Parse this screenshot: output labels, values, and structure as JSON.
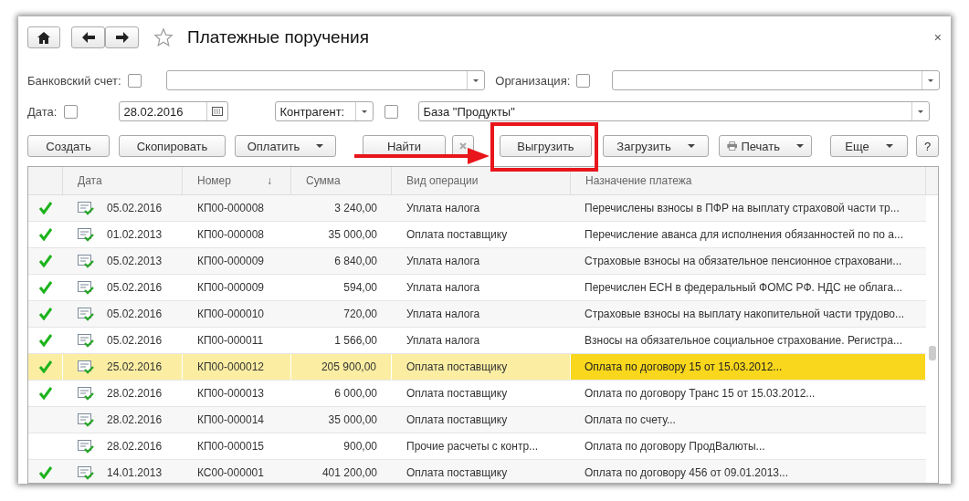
{
  "window": {
    "title": "Платежные поручения",
    "close": "×"
  },
  "filters": {
    "bank_account": {
      "label": "Банковский счет:",
      "checked": false
    },
    "organization": {
      "label": "Организация:",
      "checked": false
    },
    "date": {
      "label": "Дата:",
      "checked": false,
      "value": "28.02.2016"
    },
    "counterparty": {
      "label": "Контрагент:",
      "checked": false,
      "value": "База \"Продукты\""
    }
  },
  "toolbar": [
    {
      "label": "Создать",
      "kind": "plain"
    },
    {
      "label": "Скопировать",
      "kind": "plain"
    },
    {
      "label": "Оплатить",
      "kind": "menu"
    },
    {
      "label": "Найти",
      "kind": "plain"
    },
    {
      "label": "Выгрузить",
      "kind": "plain"
    },
    {
      "label": "Загрузить",
      "kind": "menu"
    },
    {
      "label": "Печать",
      "kind": "print"
    },
    {
      "label": "Еще",
      "kind": "menu"
    },
    {
      "label": "?",
      "kind": "plain"
    }
  ],
  "table": {
    "columns": [
      {
        "label": "Дата"
      },
      {
        "label": "Номер",
        "sort": "↓"
      },
      {
        "label": "Сумма"
      },
      {
        "label": "Вид операции"
      },
      {
        "label": "Назначение платежа"
      }
    ],
    "rows": [
      {
        "posted": true,
        "selected": false,
        "date": "05.02.2016",
        "number": "КП00-000008",
        "sum": "3 240,00",
        "operation": "Уплата налога",
        "purpose": "Перечислены взносы в ПФР на  выплату страховой части тр..."
      },
      {
        "posted": true,
        "selected": false,
        "date": "01.02.2013",
        "number": "КП00-000008",
        "sum": "35 000,00",
        "operation": "Оплата поставщику",
        "purpose": "Перечисление аванса для исполнения обязанностей по по а..."
      },
      {
        "posted": true,
        "selected": false,
        "date": "05.02.2013",
        "number": "КП00-000009",
        "sum": "6 840,00",
        "operation": "Уплата налога",
        "purpose": "Страховые взносы на обязательное пенсионное страховани..."
      },
      {
        "posted": true,
        "selected": false,
        "date": "05.02.2016",
        "number": "КП00-000009",
        "sum": "594,00",
        "operation": "Уплата налога",
        "purpose": "Перечислен ЕСН в федеральный ФОМС РФ. НДС не облага..."
      },
      {
        "posted": true,
        "selected": false,
        "date": "05.02.2016",
        "number": "КП00-000010",
        "sum": "720,00",
        "operation": "Уплата налога",
        "purpose": "Страховые взносы на выплату накопительной части трудово..."
      },
      {
        "posted": true,
        "selected": false,
        "date": "05.02.2016",
        "number": "КП00-000011",
        "sum": "1 566,00",
        "operation": "Уплата налога",
        "purpose": "Взносы на обязательное социальное страхование. Регистра..."
      },
      {
        "posted": true,
        "selected": true,
        "date": "25.02.2016",
        "number": "КП00-000012",
        "sum": "205 900,00",
        "operation": "Оплата поставщику",
        "purpose": "Оплата по договору 15 от 15.03.2012..."
      },
      {
        "posted": true,
        "selected": false,
        "date": "28.02.2016",
        "number": "КП00-000013",
        "sum": "6 000,00",
        "operation": "Оплата поставщику",
        "purpose": "Оплата по договору Транс 15 от 15.03.2012..."
      },
      {
        "posted": false,
        "selected": false,
        "date": "28.02.2016",
        "number": "КП00-000014",
        "sum": "35 000,00",
        "operation": "Оплата поставщику",
        "purpose": "Оплата по счету..."
      },
      {
        "posted": false,
        "selected": false,
        "date": "28.02.2016",
        "number": "КП00-000015",
        "sum": "900,00",
        "operation": "Прочие расчеты с контр...",
        "purpose": "Оплата по договору ПродВалюты..."
      },
      {
        "posted": true,
        "selected": false,
        "date": "14.01.2013",
        "number": "КС00-000001",
        "sum": "401 200,00",
        "operation": "Оплата поставщику",
        "purpose": "Оплата по договору 456 от 09.01.2013..."
      }
    ]
  }
}
